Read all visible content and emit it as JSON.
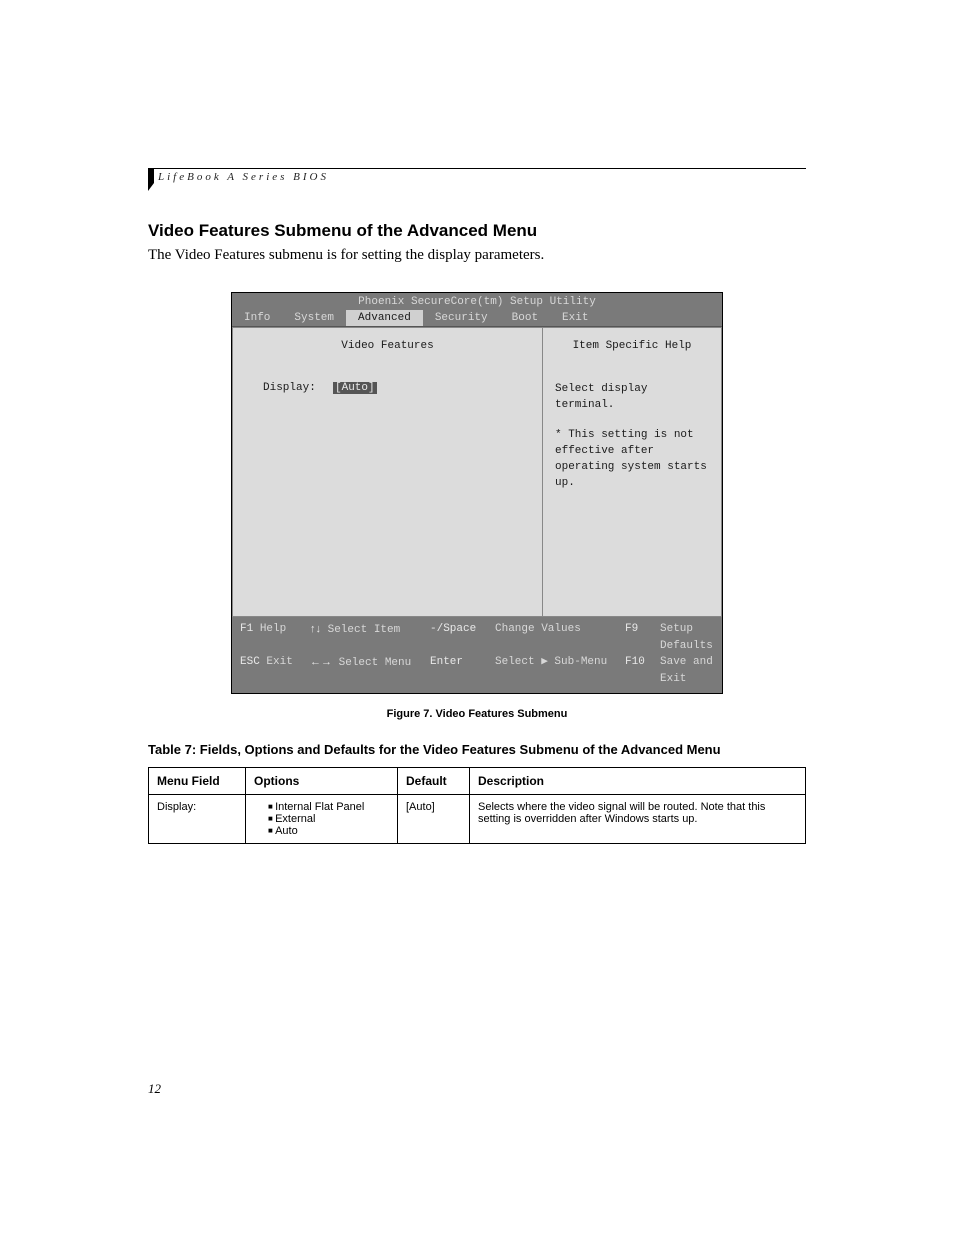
{
  "doc": {
    "series": "LifeBook A Series BIOS",
    "section_title": "Video Features Submenu of the Advanced Menu",
    "intro": "The Video Features submenu is for setting the display parameters.",
    "figure_caption": "Figure 7.  Video Features Submenu",
    "table_title": "Table 7: Fields, Options and Defaults for the Video Features Submenu of the Advanced Menu",
    "page_number": "12"
  },
  "bios": {
    "utility_title": "Phoenix SecureCore(tm) Setup Utility",
    "tabs": {
      "info": "Info",
      "system": "System",
      "advanced": "Advanced",
      "security": "Security",
      "boot": "Boot",
      "exit": "Exit"
    },
    "active_tab": "Advanced",
    "subtitle": "Video Features",
    "help_panel_title": "Item Specific Help",
    "field": {
      "label": "Display:",
      "value": "[Auto]"
    },
    "help_text_line1": "Select display terminal.",
    "help_text_line2": "* This setting is not effective after operating system starts up.",
    "footer": {
      "f1": "F1",
      "f1_label": "Help",
      "esc": "ESC",
      "esc_label": "Exit",
      "updown": "↑↓",
      "updown_label": "Select Item",
      "leftright": "←→",
      "leftright_label": "Select Menu",
      "minus": "-/Space",
      "minus_label": "Change Values",
      "enter": "Enter",
      "enter_label": "Select ▶ Sub-Menu",
      "f9": "F9",
      "f9_label": "Setup Defaults",
      "f10": "F10",
      "f10_label": "Save and Exit"
    }
  },
  "table": {
    "headers": {
      "menu_field": "Menu Field",
      "options": "Options",
      "default": "Default",
      "description": "Description"
    },
    "row": {
      "menu_field": "Display:",
      "options": [
        "Internal Flat Panel",
        "External",
        "Auto"
      ],
      "default": "[Auto]",
      "description": "Selects where the video signal will be routed. Note that this setting is overridden after Windows starts up."
    }
  }
}
